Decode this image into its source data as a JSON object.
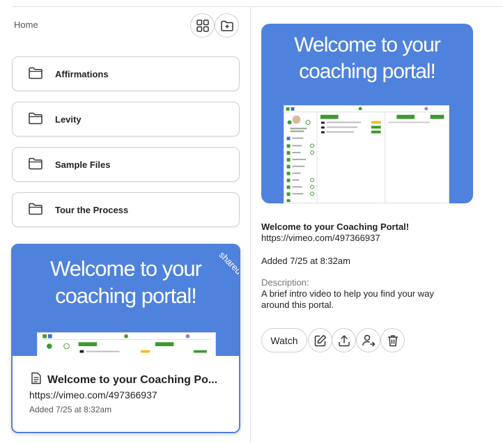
{
  "breadcrumb": {
    "home": "Home"
  },
  "toolbar": {
    "grid_icon": "grid-view-icon",
    "new_folder_icon": "folder-plus-icon"
  },
  "folders": [
    {
      "label": "Affirmations"
    },
    {
      "label": "Levity"
    },
    {
      "label": "Sample Files"
    },
    {
      "label": "Tour the Process"
    }
  ],
  "file_card": {
    "thumb_title_line1": "Welcome to your",
    "thumb_title_line2": "coaching portal!",
    "badge": "shared",
    "title": "Welcome to your Coaching Po...",
    "url": "https://vimeo.com/497366937",
    "added": "Added 7/25 at 8:32am"
  },
  "detail": {
    "preview_line1": "Welcome to your",
    "preview_line2": "coaching portal!",
    "title": "Welcome to your Coaching Portal!",
    "url": "https://vimeo.com/497366937",
    "added": "Added 7/25 at 8:32am",
    "description_label": "Description:",
    "description": "A brief intro video to help you find your way around this portal.",
    "watch_label": "Watch"
  },
  "colors": {
    "accent": "#4f82dc",
    "card_border": "#4f7fd8"
  }
}
